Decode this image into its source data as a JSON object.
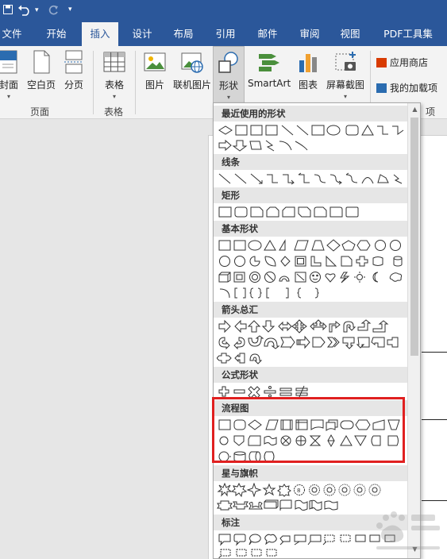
{
  "colors": {
    "brand": "#2b579a",
    "highlight": "#e02020",
    "ribbon": "#f3f3f3"
  },
  "quick_access": {
    "save_icon": "save-icon",
    "undo_icon": "undo-icon",
    "redo_icon": "redo-icon",
    "customize_icon": "customize-icon"
  },
  "tabs": [
    {
      "label": "文件"
    },
    {
      "label": "开始"
    },
    {
      "label": "插入"
    },
    {
      "label": "设计"
    },
    {
      "label": "布局"
    },
    {
      "label": "引用"
    },
    {
      "label": "邮件"
    },
    {
      "label": "审阅"
    },
    {
      "label": "视图"
    },
    {
      "label": "PDF工具集"
    }
  ],
  "ribbon": {
    "pages": {
      "cover": "封面",
      "blank": "空白页",
      "break": "分页",
      "group": "页面"
    },
    "tables": {
      "table": "表格",
      "group": "表格"
    },
    "illustrations": {
      "picture": "图片",
      "online_picture": "联机图片",
      "shapes": "形状",
      "smartart": "SmartArt",
      "chart": "图表",
      "screenshot": "屏幕截图"
    },
    "addins": {
      "store": "应用商店",
      "my_addins": "我的加载项",
      "group_tail": "项"
    }
  },
  "dropdown": {
    "sections": {
      "recent": "最近使用的形状",
      "lines": "线条",
      "rect": "矩形",
      "basic": "基本形状",
      "arrows": "箭头总汇",
      "equation": "公式形状",
      "flowchart": "流程图",
      "stars": "星与旗帜",
      "callouts": "标注"
    }
  }
}
